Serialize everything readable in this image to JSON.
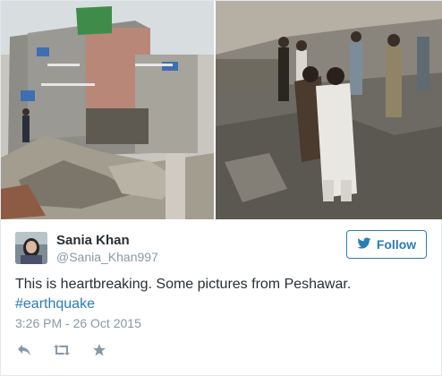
{
  "tweet": {
    "author_name": "Sania Khan",
    "author_handle": "@Sania_Khan997",
    "follow_label": "Follow",
    "text_prefix": "This is heartbreaking. Some pictures from Peshawar. ",
    "hashtag": "#earthquake",
    "timestamp": "3:26 PM - 26 Oct 2015"
  },
  "icons": {
    "follow": "twitter-bird-icon",
    "reply": "reply-icon",
    "retweet": "retweet-icon",
    "favorite": "star-icon"
  },
  "colors": {
    "link": "#2b7bb9",
    "muted": "#8899a6",
    "text": "#292f33",
    "action_icon": "#8899a6"
  }
}
